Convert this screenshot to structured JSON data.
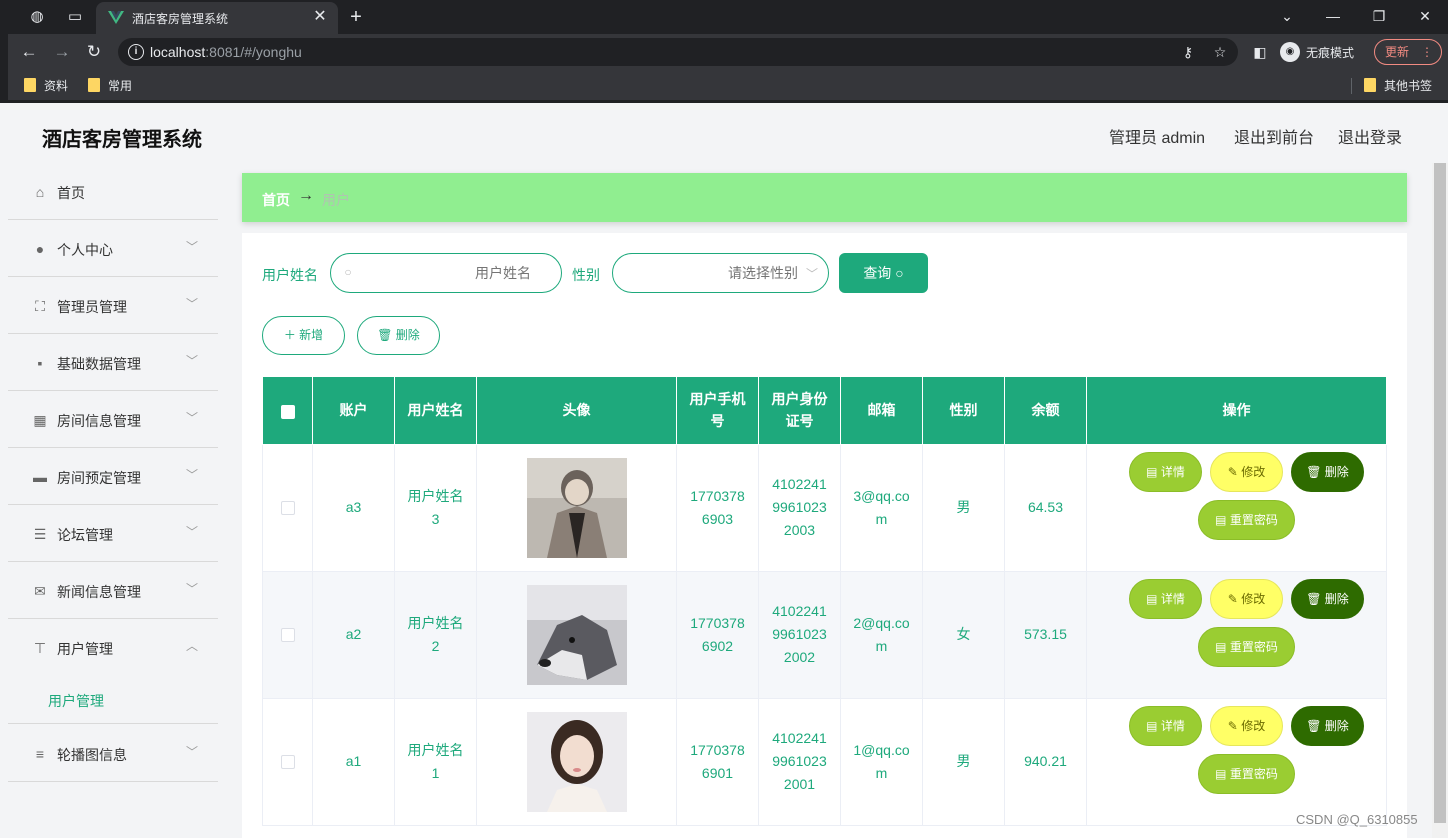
{
  "browser": {
    "tab_title": "酒店客房管理系统",
    "url_host": "localhost",
    "url_path": ":8081/#/yonghu",
    "incognito_label": "无痕模式",
    "update_label": "更新",
    "bookmarks": [
      "资料",
      "常用"
    ],
    "other_bookmarks": "其他书签"
  },
  "app": {
    "title": "酒店客房管理系统",
    "admin_label": "管理员 admin",
    "front_link": "退出到前台",
    "logout_link": "退出登录"
  },
  "sidebar": {
    "items": [
      {
        "label": "首页",
        "icon": "home-icon"
      },
      {
        "label": "个人中心",
        "icon": "user-icon"
      },
      {
        "label": "管理员管理",
        "icon": "frame-icon"
      },
      {
        "label": "基础数据管理",
        "icon": "chat-icon"
      },
      {
        "label": "房间信息管理",
        "icon": "grid-icon"
      },
      {
        "label": "房间预定管理",
        "icon": "briefcase-icon"
      },
      {
        "label": "论坛管理",
        "icon": "sliders-icon"
      },
      {
        "label": "新闻信息管理",
        "icon": "mail-icon"
      },
      {
        "label": "用户管理",
        "icon": "stamp-icon"
      },
      {
        "label": "轮播图信息",
        "icon": "list-icon"
      }
    ],
    "sub_item": "用户管理"
  },
  "breadcrumb": {
    "home": "首页",
    "separator": "→",
    "current": "用户"
  },
  "search": {
    "name_label": "用户姓名",
    "name_placeholder": "用户姓名",
    "gender_label": "性别",
    "gender_placeholder": "请选择性别",
    "query_button": "查询"
  },
  "actions": {
    "add": "新增",
    "delete": "删除"
  },
  "table": {
    "headers": [
      "账户",
      "用户姓名",
      "头像",
      "用户手机号",
      "用户身份证号",
      "邮箱",
      "性别",
      "余额",
      "操作"
    ],
    "rows": [
      {
        "account": "a3",
        "name": "用户姓名3",
        "phone": "17703786903",
        "id_card": "410224199610232003",
        "email": "3@qq.com",
        "gender": "男",
        "balance": "64.53"
      },
      {
        "account": "a2",
        "name": "用户姓名2",
        "phone": "17703786902",
        "id_card": "410224199610232002",
        "email": "2@qq.com",
        "gender": "女",
        "balance": "573.15"
      },
      {
        "account": "a1",
        "name": "用户姓名1",
        "phone": "17703786901",
        "id_card": "410224199610232001",
        "email": "1@qq.com",
        "gender": "男",
        "balance": "940.21"
      }
    ],
    "op_labels": {
      "detail": "详情",
      "edit": "修改",
      "delete": "删除",
      "reset": "重置密码"
    }
  },
  "watermark": "CSDN @Q_6310855",
  "colors": {
    "accent": "#1ea97c",
    "breadcrumb_bg": "#90ee90",
    "detail": "#9acd32",
    "edit": "#ffff66",
    "delete": "#2e6b00"
  }
}
